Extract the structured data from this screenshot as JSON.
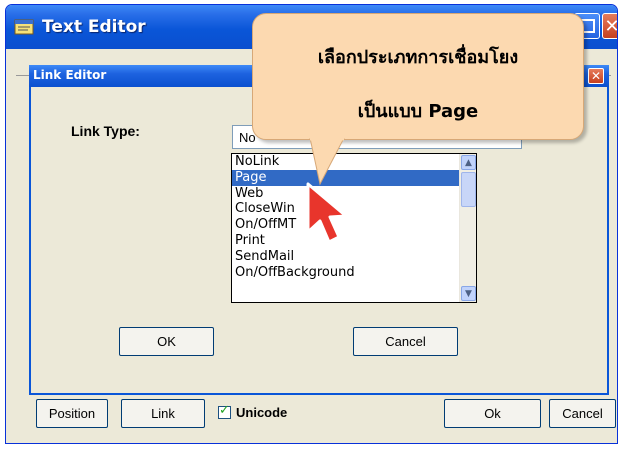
{
  "outer_window": {
    "title": "Text Editor",
    "controls": {
      "close_glyph": "✕"
    }
  },
  "dialog": {
    "title": "Link Editor",
    "close_glyph": "✕",
    "link_type_label": "Link Type:",
    "combo_value": "No",
    "list_items": [
      "NoLink",
      "Page",
      "Web",
      "CloseWin",
      "On/OffMT",
      "Print",
      "SendMail",
      "On/OffBackground"
    ],
    "selected_item": "Page",
    "ok_label": "OK",
    "cancel_label": "Cancel",
    "scroll_up_glyph": "▲",
    "scroll_down_glyph": "▼"
  },
  "bottom_bar": {
    "position_label": "Position",
    "link_label": "Link",
    "unicode_label": "Unicode",
    "unicode_checked": true,
    "ok_label": "Ok",
    "cancel_label": "Cancel"
  },
  "callout": {
    "line1": "เลือกประเภทการเชื่อมโยง",
    "line2": "เป็นแบบ  Page"
  },
  "colors": {
    "titlebar": "#0a56d8",
    "selection": "#316ac5",
    "callout_bg": "#fcd9b0",
    "cursor": "#e8352c"
  }
}
